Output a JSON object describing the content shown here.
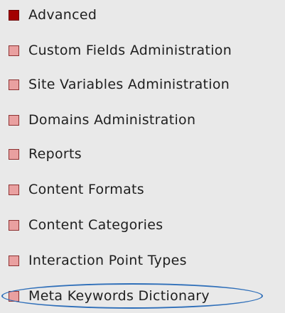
{
  "menu": {
    "items": [
      {
        "label": "Advanced"
      },
      {
        "label": "Custom Fields Administration"
      },
      {
        "label": "Site Variables Administration"
      },
      {
        "label": "Domains Administration"
      },
      {
        "label": "Reports"
      },
      {
        "label": "Content Formats"
      },
      {
        "label": "Content Categories"
      },
      {
        "label": "Interaction Point Types"
      },
      {
        "label": "Meta Keywords Dictionary"
      }
    ]
  },
  "colors": {
    "active_bullet": "#a30000",
    "bullet": "#e9a0a0",
    "bullet_border": "#8d3232",
    "panel_background": "#e9e9e9",
    "label_text": "#1e1e1e",
    "highlight_oval": "#2f6fb9"
  }
}
